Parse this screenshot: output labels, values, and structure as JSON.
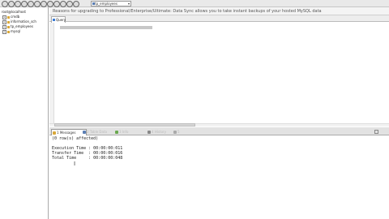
{
  "toolbar": {
    "icons": [
      "connect-icon",
      "disconnect-icon",
      "new-query-icon",
      "open-icon",
      "save-icon",
      "refresh-icon",
      "execute-icon",
      "stop-icon",
      "settings-icon",
      "schema-icon",
      "backup-icon",
      "import-icon"
    ],
    "database_select": {
      "value": "tp_employees"
    }
  },
  "sidebar": {
    "root": "root@localhost",
    "nodes": [
      "cmdb",
      "information_sch",
      "tp_employees",
      "mysql"
    ]
  },
  "banner": {
    "text": "Reasons for upgrading to Professional/Enterprise/Ultimate: Data Sync allows you to take instant backups of your hosted MySQL data"
  },
  "query_tab": {
    "label": "Query"
  },
  "result_tabs": [
    {
      "label": "1 Messages",
      "color": "#d9a83a"
    },
    {
      "label": "2 Table Data",
      "color": "#5b7fb5"
    },
    {
      "label": "3 Info",
      "color": "#6aa84f"
    },
    {
      "label": "4 History",
      "color": "#888888"
    },
    {
      "label": "5",
      "color": "#aaaaaa"
    }
  ],
  "messages": [
    "(0 row(s) affected)",
    "",
    "Execution Time : 00:00:00:011",
    "Transfer Time  : 00:00:00:016",
    "Total Time     : 00:00:00:048"
  ]
}
